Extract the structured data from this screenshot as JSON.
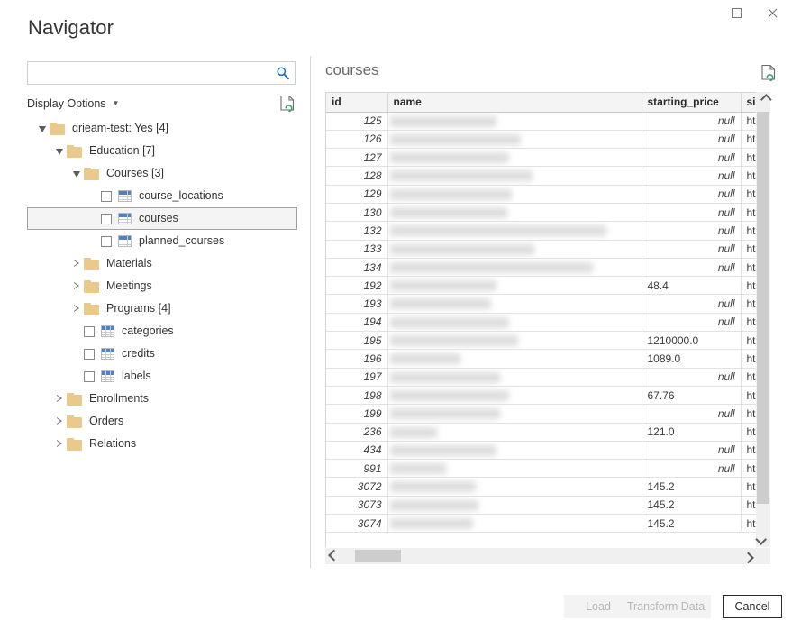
{
  "window": {
    "title": "Navigator",
    "controls": [
      {
        "name": "maximize",
        "icon": "maximize-icon"
      },
      {
        "name": "close",
        "icon": "close-icon"
      }
    ]
  },
  "left": {
    "search": {
      "value": "",
      "placeholder": "",
      "icon": "search-icon"
    },
    "display_options_label": "Display Options",
    "refresh_icon": "refresh-document-icon",
    "tree": [
      {
        "label": "drieam-test: Yes [4]",
        "type": "folder",
        "depth": 0,
        "expander": "open",
        "checkbox": false,
        "selected": false
      },
      {
        "label": "Education [7]",
        "type": "folder",
        "depth": 1,
        "expander": "open",
        "checkbox": false,
        "selected": false
      },
      {
        "label": "Courses [3]",
        "type": "folder",
        "depth": 2,
        "expander": "open",
        "checkbox": false,
        "selected": false
      },
      {
        "label": "course_locations",
        "type": "table",
        "depth": 3,
        "expander": "none",
        "checkbox": true,
        "selected": false
      },
      {
        "label": "courses",
        "type": "table",
        "depth": 3,
        "expander": "none",
        "checkbox": true,
        "selected": true
      },
      {
        "label": "planned_courses",
        "type": "table",
        "depth": 3,
        "expander": "none",
        "checkbox": true,
        "selected": false
      },
      {
        "label": "Materials",
        "type": "folder",
        "depth": 2,
        "expander": "closed",
        "checkbox": false,
        "selected": false
      },
      {
        "label": "Meetings",
        "type": "folder",
        "depth": 2,
        "expander": "closed",
        "checkbox": false,
        "selected": false
      },
      {
        "label": "Programs [4]",
        "type": "folder",
        "depth": 2,
        "expander": "closed",
        "checkbox": false,
        "selected": false
      },
      {
        "label": "categories",
        "type": "table",
        "depth": 2,
        "expander": "none",
        "checkbox": true,
        "selected": false
      },
      {
        "label": "credits",
        "type": "table",
        "depth": 2,
        "expander": "none",
        "checkbox": true,
        "selected": false
      },
      {
        "label": "labels",
        "type": "table",
        "depth": 2,
        "expander": "none",
        "checkbox": true,
        "selected": false
      },
      {
        "label": "Enrollments",
        "type": "folder",
        "depth": 1,
        "expander": "closed",
        "checkbox": false,
        "selected": false
      },
      {
        "label": "Orders",
        "type": "folder",
        "depth": 1,
        "expander": "closed",
        "checkbox": false,
        "selected": false
      },
      {
        "label": "Relations",
        "type": "folder",
        "depth": 1,
        "expander": "closed",
        "checkbox": false,
        "selected": false
      }
    ]
  },
  "preview": {
    "title": "courses",
    "refresh_icon": "refresh-document-icon",
    "columns": [
      "id",
      "name",
      "starting_price",
      "signu"
    ],
    "rows": [
      {
        "id": "125",
        "name": "",
        "starting_price": "null",
        "signup_url": "ht",
        "name_bar": 118
      },
      {
        "id": "126",
        "name": "",
        "starting_price": "null",
        "signup_url": "ht",
        "name_bar": 145
      },
      {
        "id": "127",
        "name": "",
        "starting_price": "null",
        "signup_url": "ht",
        "name_bar": 132
      },
      {
        "id": "128",
        "name": "",
        "starting_price": "null",
        "signup_url": "ht",
        "name_bar": 158
      },
      {
        "id": "129",
        "name": "",
        "starting_price": "null",
        "signup_url": "ht",
        "name_bar": 135
      },
      {
        "id": "130",
        "name": "",
        "starting_price": "null",
        "signup_url": "ht",
        "name_bar": 130
      },
      {
        "id": "132",
        "name": "",
        "starting_price": "null",
        "signup_url": "ht",
        "name_bar": 240
      },
      {
        "id": "133",
        "name": "",
        "starting_price": "null",
        "signup_url": "ht",
        "name_bar": 160
      },
      {
        "id": "134",
        "name": "",
        "starting_price": "null",
        "signup_url": "ht",
        "name_bar": 225
      },
      {
        "id": "192",
        "name": "",
        "starting_price": "48.4",
        "signup_url": "ht",
        "name_bar": 118
      },
      {
        "id": "193",
        "name": "",
        "starting_price": "null",
        "signup_url": "ht",
        "name_bar": 112
      },
      {
        "id": "194",
        "name": "",
        "starting_price": "null",
        "signup_url": "ht",
        "name_bar": 132
      },
      {
        "id": "195",
        "name": "",
        "starting_price": "1210000.0",
        "signup_url": "ht",
        "name_bar": 142
      },
      {
        "id": "196",
        "name": "",
        "starting_price": "1089.0",
        "signup_url": "ht",
        "name_bar": 78
      },
      {
        "id": "197",
        "name": "",
        "starting_price": "null",
        "signup_url": "ht",
        "name_bar": 122
      },
      {
        "id": "198",
        "name": "",
        "starting_price": "67.76",
        "signup_url": "ht",
        "name_bar": 132
      },
      {
        "id": "199",
        "name": "",
        "starting_price": "null",
        "signup_url": "ht",
        "name_bar": 122
      },
      {
        "id": "236",
        "name": "",
        "starting_price": "121.0",
        "signup_url": "ht",
        "name_bar": 52
      },
      {
        "id": "434",
        "name": "",
        "starting_price": "null",
        "signup_url": "ht",
        "name_bar": 118
      },
      {
        "id": "991",
        "name": "",
        "starting_price": "null",
        "signup_url": "ht",
        "name_bar": 62
      },
      {
        "id": "3072",
        "name": "",
        "starting_price": "145.2",
        "signup_url": "ht",
        "name_bar": 95
      },
      {
        "id": "3073",
        "name": "",
        "starting_price": "145.2",
        "signup_url": "ht",
        "name_bar": 98
      },
      {
        "id": "3074",
        "name": "",
        "starting_price": "145.2",
        "signup_url": "ht",
        "name_bar": 92
      }
    ]
  },
  "footer": {
    "load_label": "Load",
    "transform_label": "Transform Data",
    "cancel_label": "Cancel"
  },
  "colors": {
    "accent_blue": "#4a84c4",
    "folder": "#eac98d",
    "selection_bg": "#f4f4f4",
    "header_bg": "#f4f4f4"
  }
}
